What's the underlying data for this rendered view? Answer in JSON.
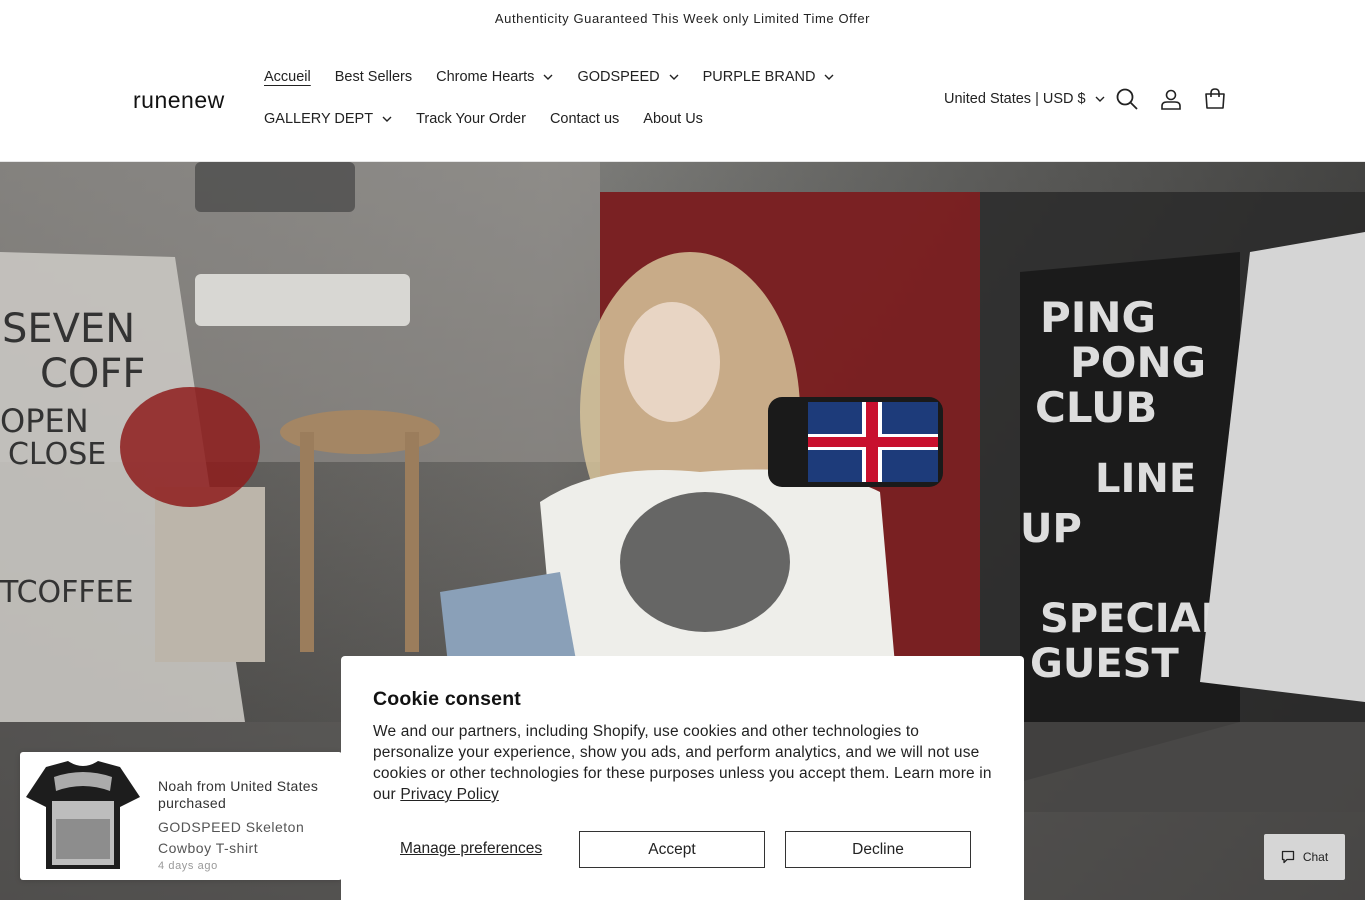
{
  "announcement": {
    "text": "Authenticity Guaranteed This Week only Limited Time Offer"
  },
  "header": {
    "logo": "runenew",
    "nav": [
      {
        "label": "Accueil",
        "active": true,
        "dropdown": false
      },
      {
        "label": "Best Sellers",
        "dropdown": false
      },
      {
        "label": "Chrome Hearts",
        "dropdown": true
      },
      {
        "label": "GODSPEED",
        "dropdown": true
      },
      {
        "label": "PURPLE BRAND",
        "dropdown": true
      },
      {
        "label": "GALLERY DEPT",
        "dropdown": true
      },
      {
        "label": "Track Your Order",
        "dropdown": false
      },
      {
        "label": "Contact us",
        "dropdown": false
      },
      {
        "label": "About Us",
        "dropdown": false
      }
    ],
    "country_selector": "United States | USD $",
    "icons": [
      "search-icon",
      "account-icon",
      "cart-icon"
    ]
  },
  "cookie_banner": {
    "title": "Cookie consent",
    "body": "We and our partners, including Shopify, use cookies and other technologies to personalize your experience, show you ads, and perform analytics, and we will not use cookies or other technologies for these purposes unless you accept them. Learn more in our ",
    "link": "Privacy Policy",
    "manage_label": "Manage preferences",
    "accept_label": "Accept",
    "decline_label": "Decline"
  },
  "purchase_popup": {
    "line1": "Noah from United States purchased",
    "product": "GODSPEED Skeleton Cowboy T-shirt",
    "time": "4 days ago"
  },
  "chat": {
    "label": "Chat"
  },
  "colors": {
    "text": "#121212",
    "border": "#333333",
    "chat_bg": "#d6d6d6"
  }
}
